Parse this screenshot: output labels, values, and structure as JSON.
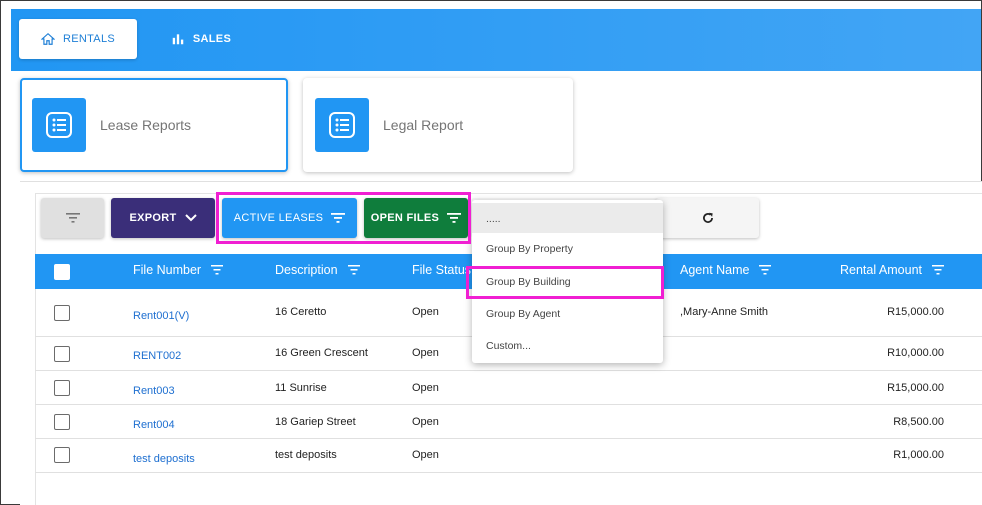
{
  "tabs": [
    {
      "label": "RENTALS",
      "icon": "home-icon"
    },
    {
      "label": "SALES",
      "icon": "bar-chart-icon"
    }
  ],
  "report_cards": [
    {
      "label": "Lease Reports",
      "icon": "list-icon"
    },
    {
      "label": "Legal Report",
      "icon": "list-icon"
    }
  ],
  "toolbar": {
    "filter_icon": "filter-icon",
    "export_label": "EXPORT",
    "active_leases_label": "ACTIVE LEASES",
    "open_files_label": "OPEN FILES",
    "refresh_icon": "refresh-icon"
  },
  "table": {
    "columns": [
      "File Number",
      "Description",
      "File Status",
      "Agent Name",
      "Rental Amount"
    ],
    "rows": [
      {
        "file_number": "Rent001(V)",
        "description": "16 Ceretto",
        "status": "Open",
        "agent": ",Mary-Anne Smith",
        "amount": "R15,000.00"
      },
      {
        "file_number": "RENT002",
        "description": "16 Green Crescent",
        "status": "Open",
        "agent": "",
        "amount": "R10,000.00"
      },
      {
        "file_number": "Rent003",
        "description": "11 Sunrise",
        "status": "Open",
        "agent": "",
        "amount": "R15,000.00"
      },
      {
        "file_number": "Rent004",
        "description": "18 Gariep Street",
        "status": "Open",
        "agent": "",
        "amount": "R8,500.00"
      },
      {
        "file_number": "test deposits",
        "description": "test deposits",
        "status": "Open",
        "agent": "",
        "amount": "R1,000.00"
      }
    ]
  },
  "group_menu": {
    "items": [
      ".....",
      "Group By Property",
      "Group By Building",
      "Group By Agent",
      "Custom..."
    ],
    "highlighted": "Group By Building"
  },
  "colors": {
    "primary": "#2196f3",
    "export": "#3a2e79",
    "open_files": "#0f7d3c",
    "highlight": "#f01fd2"
  }
}
